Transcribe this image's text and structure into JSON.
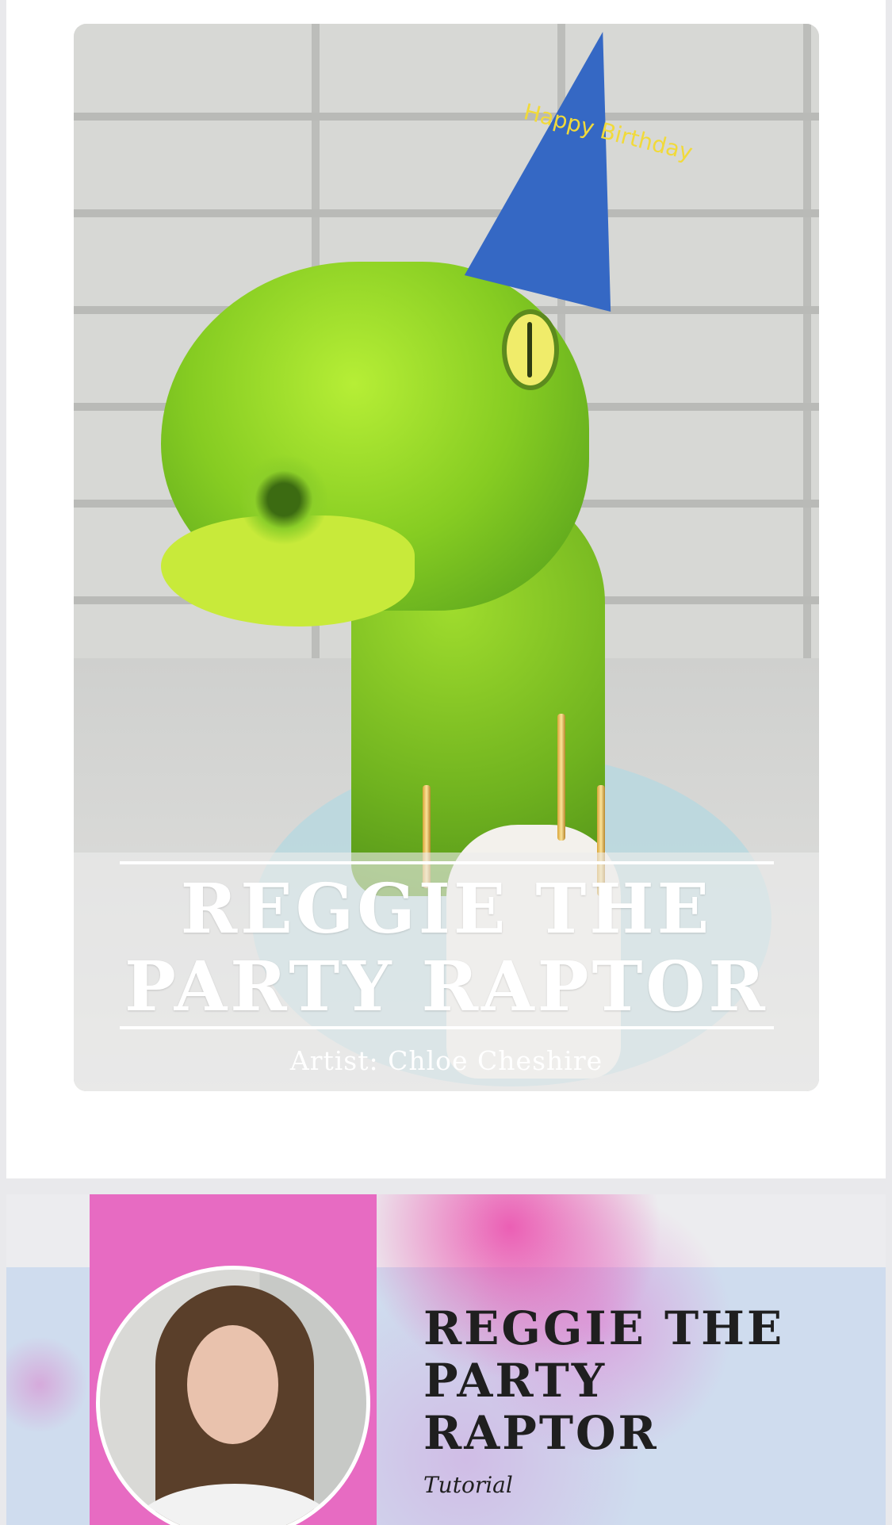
{
  "hero": {
    "title_line1": "REGGIE THE",
    "title_line2": "PARTY RAPTOR",
    "artist": "Artist: Chloe Cheshire",
    "hat_text": "Happy Birthday"
  },
  "banner": {
    "title_line1": "REGGIE THE",
    "title_line2": "PARTY",
    "title_line3": "RAPTOR",
    "subtitle": "Tutorial"
  },
  "colors": {
    "page_bg": "#e9e9ec",
    "hero_title": "#ffffff",
    "banner_pink": "#e76bc2",
    "banner_blue": "#cfdcee",
    "banner_text": "#1f1f1f"
  }
}
